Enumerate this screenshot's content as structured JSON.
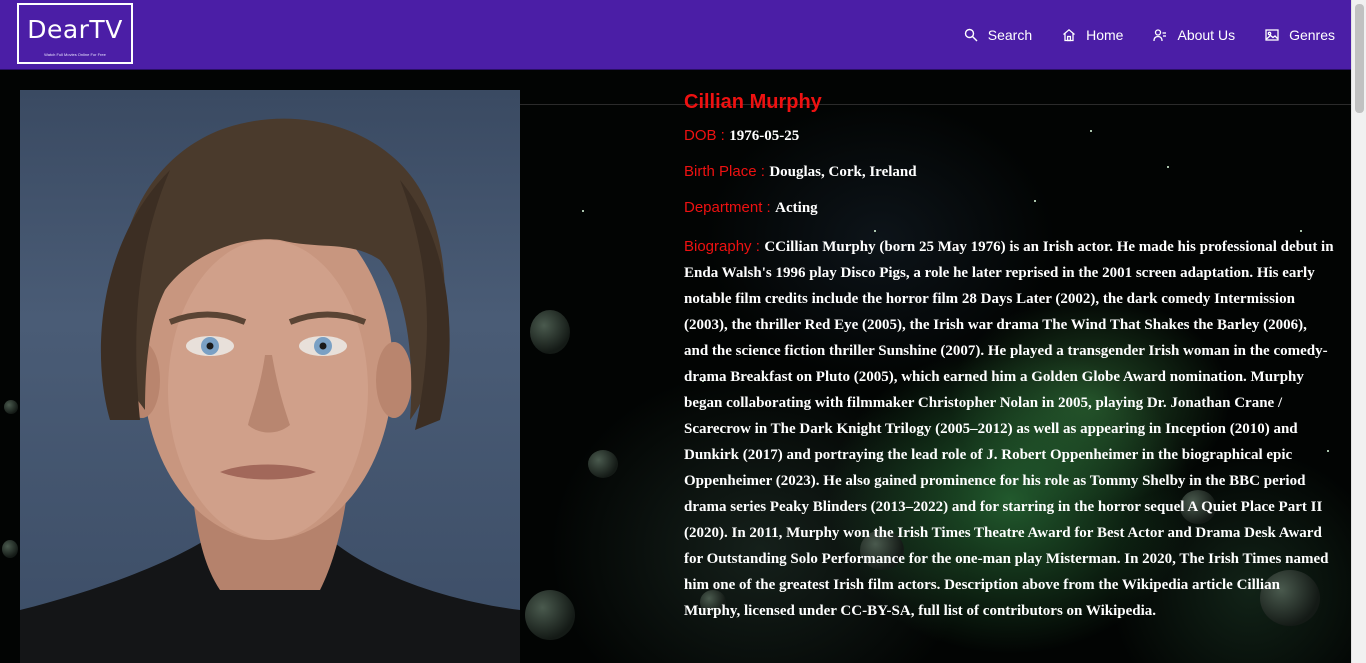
{
  "navbar": {
    "logo_title": "DearTV",
    "logo_tagline": "Watch Full Movies Online For Free",
    "links": [
      {
        "label": "Search",
        "icon": "search-icon"
      },
      {
        "label": "Home",
        "icon": "home-icon"
      },
      {
        "label": "About Us",
        "icon": "about-us-icon"
      },
      {
        "label": "Genres",
        "icon": "image-icon"
      }
    ],
    "background_color": "#4b1ea6"
  },
  "person": {
    "name": "Cillian Murphy",
    "dob_label": "DOB :",
    "dob": "1976-05-25",
    "birth_place_label": "Birth Place :",
    "birth_place": "Douglas, Cork, Ireland",
    "department_label": "Department :",
    "department": "Acting",
    "biography_label": "Biography :",
    "biography": "CCillian Murphy (born 25 May 1976) is an Irish actor. He made his professional debut in Enda Walsh's 1996 play Disco Pigs, a role he later reprised in the 2001 screen adaptation. His early notable film credits include the horror film 28 Days Later (2002), the dark comedy Intermission (2003), the thriller Red Eye (2005), the Irish war drama The Wind That Shakes the Barley (2006), and the science fiction thriller Sunshine (2007). He played a transgender Irish woman in the comedy-drama Breakfast on Pluto (2005), which earned him a Golden Globe Award nomination. Murphy began collaborating with filmmaker Christopher Nolan in 2005, playing Dr. Jonathan Crane / Scarecrow in The Dark Knight Trilogy (2005–2012) as well as appearing in Inception (2010) and Dunkirk (2017) and portraying the lead role of J. Robert Oppenheimer in the biographical epic Oppenheimer (2023). He also gained prominence for his role as Tommy Shelby in the BBC period drama series Peaky Blinders (2013–2022) and for starring in the horror sequel A Quiet Place Part II (2020). In 2011, Murphy won the Irish Times Theatre Award for Best Actor and Drama Desk Award for Outstanding Solo Performance for the one-man play Misterman. In 2020, The Irish Times named him one of the greatest Irish film actors. Description above from the Wikipedia article Cillian Murphy, licensed under CC-BY-SA, full list of contributors on Wikipedia."
  },
  "colors": {
    "label_red": "#ee1111",
    "text_white": "#ffffff"
  }
}
